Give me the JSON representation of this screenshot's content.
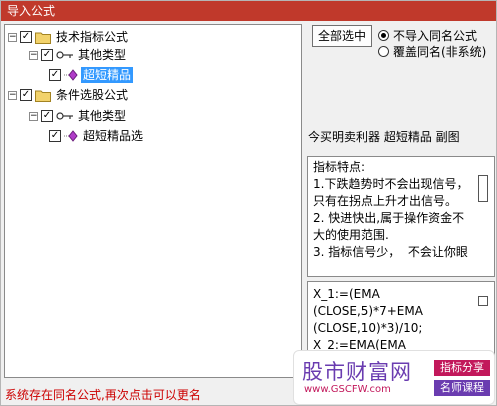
{
  "window": {
    "title": "导入公式"
  },
  "tree": {
    "root1": {
      "label": "技术指标公式",
      "checked": true,
      "expanded": true
    },
    "root1_child": {
      "label": "其他类型",
      "checked": true,
      "expanded": true
    },
    "root1_leaf": {
      "label": "超短精品",
      "checked": true,
      "selected": true
    },
    "root2": {
      "label": "条件选股公式",
      "checked": true,
      "expanded": true
    },
    "root2_child": {
      "label": "其他类型",
      "checked": true,
      "expanded": true
    },
    "root2_leaf": {
      "label": "超短精品选",
      "checked": true,
      "selected": false
    },
    "expander_symbol": "−",
    "check_mark": "✓"
  },
  "options": {
    "select_all_label": "全部选中",
    "radio_skip_label": "不导入同名公式",
    "radio_overwrite_label": "覆盖同名(非系统)",
    "radio_skip_checked": true
  },
  "formula": {
    "title": "今买明卖利器 超短精品 副图",
    "description": "指标特点:\n1.下跌趋势时不会出现信号，只有在拐点上升才出信号。\n2. 快进快出,属于操作资金不大的使用范围.\n3. 指标信号少，  不会让你眼",
    "code": "X_1:=(EMA\n(CLOSE,5)*7+EMA\n(CLOSE,10)*3)/10;\nX_2:=EMA(EMA"
  },
  "status_text": "系统存在同名公式,再次点击可以更名",
  "watermark": {
    "site": "股市财富网",
    "url": "www.GSCFW.com",
    "tag1": "指标分享",
    "tag2": "名师课程"
  },
  "colors": {
    "titlebar": "#c0392b",
    "selection": "#3399ff",
    "status": "#cc0000",
    "folder": "#f2d26b",
    "gem": "#b03cc8"
  }
}
